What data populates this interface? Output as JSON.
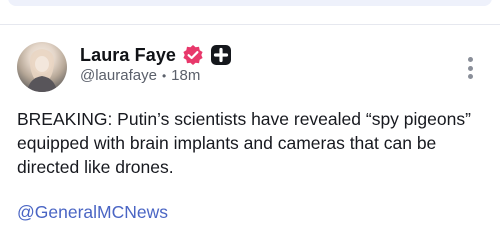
{
  "post": {
    "author": {
      "display_name": "Laura Faye",
      "handle": "@laurafaye",
      "time_ago": "18m",
      "verified_icon": "verified-badge-icon",
      "extra_icon": "plus-badge-icon"
    },
    "text": "BREAKING: Putin’s scientists have revealed “spy pigeons” equipped with brain implants and cameras that can be directed like drones.",
    "mention": "@GeneralMCNews",
    "separator": "•",
    "more_icon": "more-vertical-icon"
  },
  "colors": {
    "verified": "#e8386b",
    "mention": "#4a65c4",
    "handle": "#5b606b"
  }
}
